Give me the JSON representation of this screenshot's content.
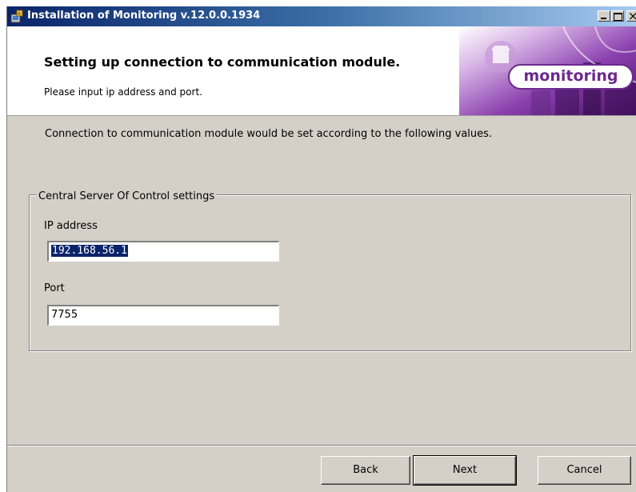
{
  "window": {
    "title": "Installation of Monitoring v.12.0.0.1934",
    "icon": "installer-icon"
  },
  "banner": {
    "title": "Setting up connection to communication module.",
    "subtitle": "Please input ip address and port.",
    "logo_text": "monitoring",
    "accent_color": "#6b2a8c"
  },
  "main": {
    "intro_text": "Connection to communication module would be set according to the following values.",
    "group": {
      "legend": "Central Server Of Control settings",
      "ip_label": "IP address",
      "ip_value": "192.168.56.1",
      "port_label": "Port",
      "port_value": "7755"
    }
  },
  "buttons": {
    "back": "Back",
    "next": "Next",
    "cancel": "Cancel"
  }
}
